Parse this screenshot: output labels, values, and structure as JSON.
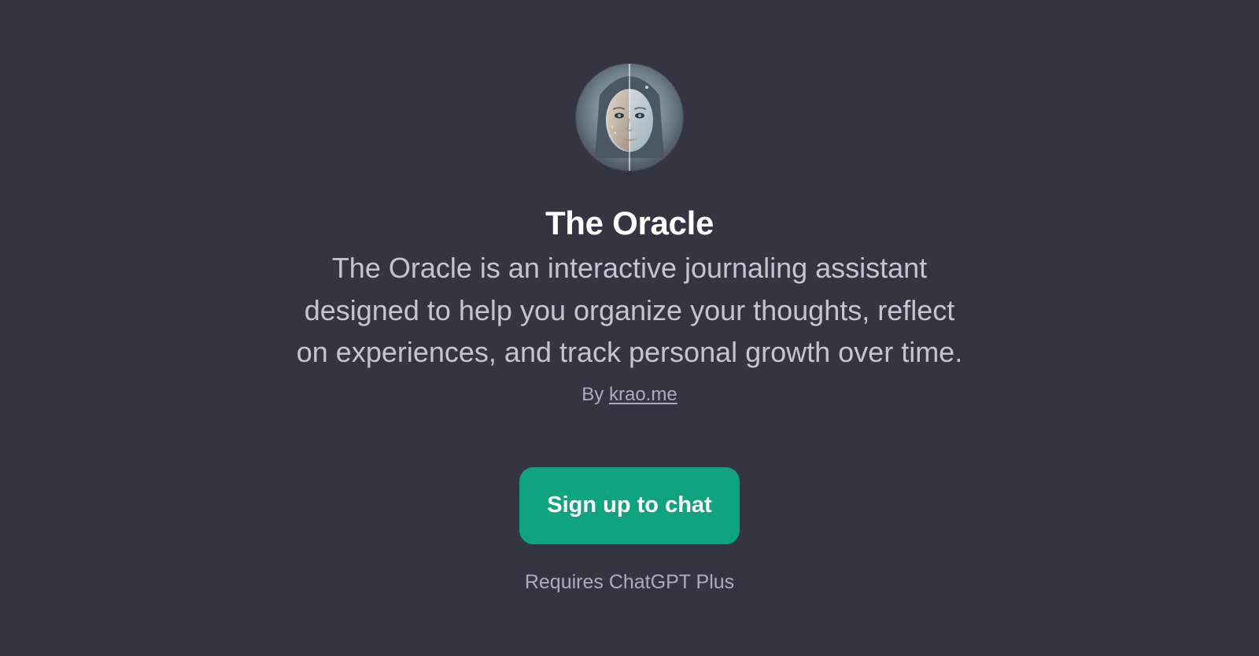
{
  "gpt": {
    "avatar_icon": "oracle-face-avatar",
    "title": "The Oracle",
    "description": "The Oracle is an interactive journaling assistant designed to help you organize your thoughts, reflect on experiences, and track personal growth over time.",
    "by_prefix": "By",
    "author": "krao.me"
  },
  "cta": {
    "label": "Sign up to chat"
  },
  "footer": {
    "requires": "Requires ChatGPT Plus"
  },
  "colors": {
    "background": "#343541",
    "title": "#ffffff",
    "description": "#c5c5d2",
    "muted": "#acacbe",
    "accent": "#10a37f"
  }
}
